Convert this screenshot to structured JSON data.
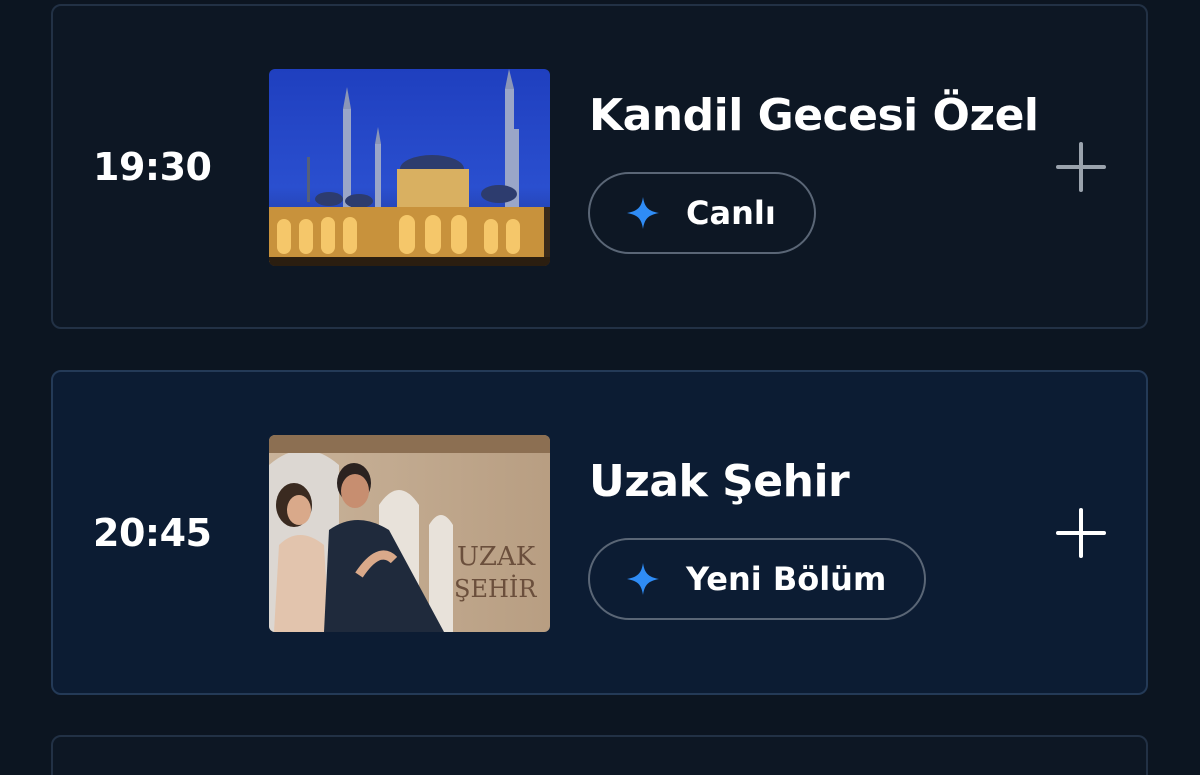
{
  "schedule": [
    {
      "time": "19:30",
      "title": "Kandil Gecesi Özel",
      "badge": "Canlı",
      "active": false,
      "add_icon_color": "#9aa3ad"
    },
    {
      "time": "20:45",
      "title": "Uzak Şehir",
      "badge": "Yeni Bölüm",
      "active": true,
      "add_icon_color": "#ffffff",
      "thumbnail_text": {
        "line1": "UZAK",
        "line2": "ŞEHİR"
      }
    }
  ],
  "colors": {
    "background": "#0c1521",
    "card": "#0d1724",
    "card_active": "#0c1c33",
    "accent_sparkle": "#2f8cf5"
  },
  "icons": {
    "badge": "sparkle-icon",
    "add": "plus-icon"
  }
}
